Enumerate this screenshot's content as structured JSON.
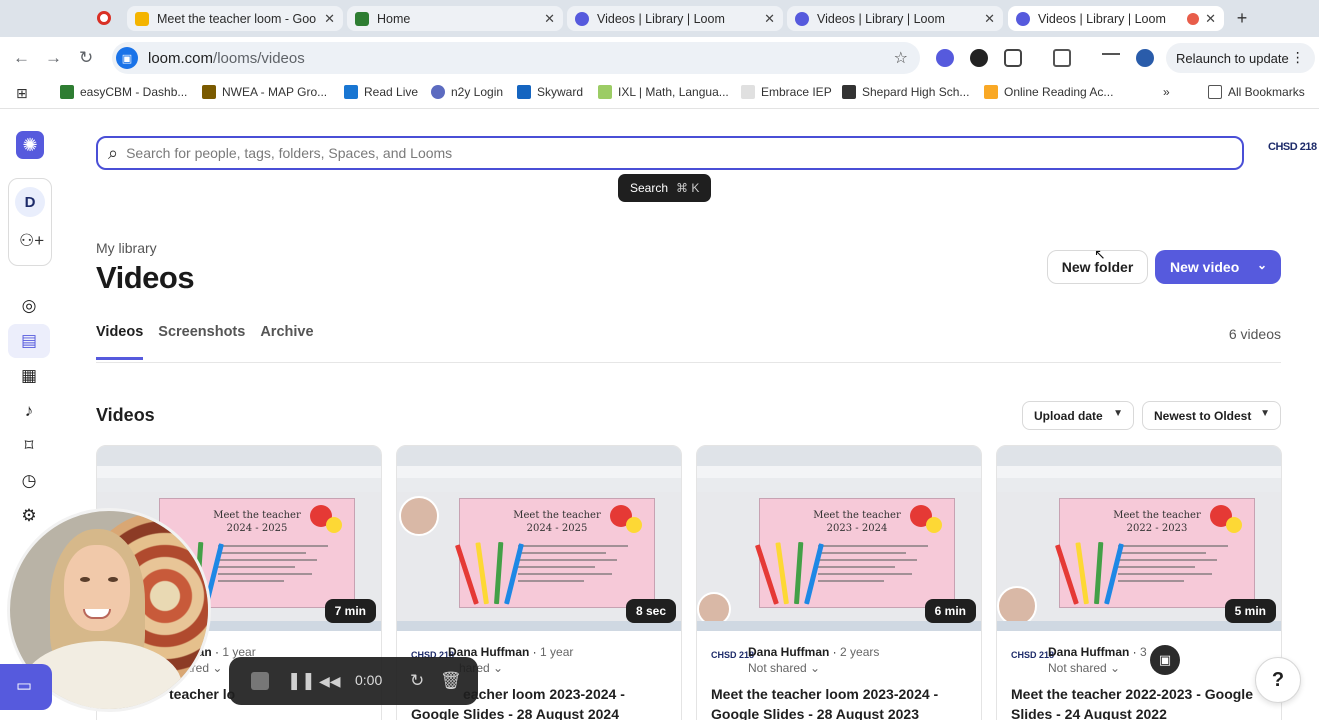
{
  "browser": {
    "tabs": [
      {
        "title": "Meet the teacher loom - Goo",
        "active": false
      },
      {
        "title": "Home",
        "active": false
      },
      {
        "title": "Videos | Library | Loom",
        "active": false
      },
      {
        "title": "Videos | Library | Loom",
        "active": false
      },
      {
        "title": "Videos | Library | Loom",
        "active": true
      }
    ],
    "url_host": "loom.com",
    "url_path": "/looms/videos",
    "relaunch_label": "Relaunch to update",
    "bookmarks": [
      "easyCBM - Dashb...",
      "NWEA - MAP Gro...",
      "Read Live",
      "n2y Login",
      "Skyward",
      "IXL | Math, Langua...",
      "Embrace IEP",
      "Shepard High Sch...",
      "Online Reading Ac...",
      "All Bookmarks"
    ]
  },
  "app": {
    "accent": "#565ADD",
    "workspace_initial": "D",
    "org_logo": "CHSD 218",
    "search": {
      "placeholder": "Search for people, tags, folders, Spaces, and Looms",
      "tooltip": "Search",
      "shortcut": "⌘  K"
    },
    "breadcrumb": "My library",
    "title": "Videos",
    "new_folder": "New folder",
    "new_video": "New video",
    "tabs": [
      "Videos",
      "Screenshots",
      "Archive"
    ],
    "video_count": "6 videos",
    "section_title": "Videos",
    "sort_field": "Upload date",
    "sort_order": "Newest to Oldest",
    "videos": [
      {
        "owner": "Dana Huffman",
        "owner_visible": "man",
        "age": "1 year",
        "shared": "Not shared",
        "shared_visible": "ared",
        "duration": "7 min",
        "title": "Meet the teacher loom 2024-2025",
        "title_visible": "teacher lo",
        "slide_title": "Meet the teacher",
        "slide_years": "2024 - 2025"
      },
      {
        "owner": "Dana Huffman",
        "age": "1 year",
        "shared": "Not shared",
        "shared_visible": "hared",
        "duration": "8 sec",
        "title": "Meet the teacher loom 2023-2024 - Google Slides - 28 August 2024",
        "title_visible": "eacher loom 2023-2024 - Google Slides - 28 August 2024",
        "slide_title": "Meet the teacher",
        "slide_years": "2024 - 2025"
      },
      {
        "owner": "Dana Huffman",
        "age": "2 years",
        "shared": "Not shared",
        "duration": "6 min",
        "title": "Meet the teacher loom 2023-2024 - Google Slides - 28 August 2023",
        "slide_title": "Meet the teacher",
        "slide_years": "2023 - 2024"
      },
      {
        "owner": "Dana Huffman",
        "age": "3",
        "shared": "Not shared",
        "duration": "5 min",
        "title": "Meet the teacher 2022-2023 - Google Slides - 24 August 2022",
        "slide_title": "Meet the teacher",
        "slide_years": "2022 - 2023"
      }
    ],
    "recorder": {
      "time": "0:00"
    },
    "help": "?"
  }
}
